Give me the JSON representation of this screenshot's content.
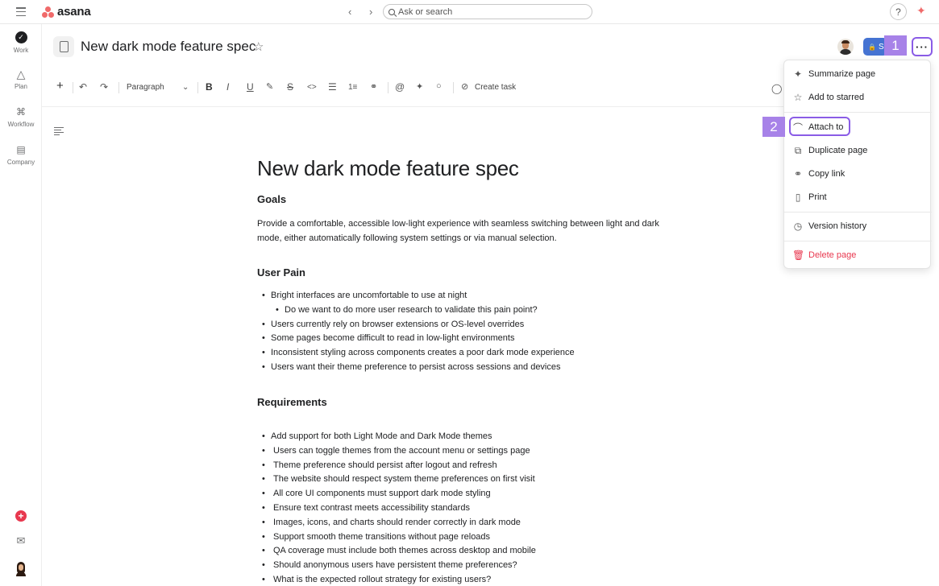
{
  "topbar": {
    "brand": "asana",
    "nav_arrows": "‹ ›",
    "search_placeholder": "Ask or search",
    "help": "?",
    "ai_icon": "sparkle-icon"
  },
  "sidebar": {
    "items": [
      {
        "label": "Work",
        "icon": "check-circle-icon"
      },
      {
        "label": "Plan",
        "icon": "triangle-icon"
      },
      {
        "label": "Workflow",
        "icon": "workflow-icon"
      },
      {
        "label": "Company",
        "icon": "building-icon"
      }
    ],
    "bottom": [
      "create-icon",
      "inbox-icon",
      "user-avatar"
    ]
  },
  "header": {
    "title": "New dark mode feature spec",
    "share_label": "S",
    "more_label": "···"
  },
  "badges": {
    "first": "1",
    "second": "2"
  },
  "toolbar": {
    "block_type": "Paragraph",
    "create_task": "Create task"
  },
  "document": {
    "title": "New dark mode feature spec",
    "goals_heading": "Goals",
    "goals_text": "Provide a comfortable, accessible low-light experience with seamless switching between light and dark mode, either automatically following system settings or via manual selection.",
    "pain_heading": "User Pain",
    "pain_items": [
      {
        "text": "Bright interfaces are uncomfortable to use at night",
        "sub": false
      },
      {
        "text": "Do we want to do more user research to validate this pain point?",
        "sub": true
      },
      {
        "text": "Users currently rely on browser extensions or OS-level overrides",
        "sub": false
      },
      {
        "text": "Some pages become difficult to read in low-light environments",
        "sub": false
      },
      {
        "text": "Inconsistent styling across components creates a poor dark mode experience",
        "sub": false
      },
      {
        "text": "Users want their theme preference to persist across sessions and devices",
        "sub": false
      }
    ],
    "req_heading": "Requirements",
    "req_items": [
      "Add support for both Light Mode and Dark Mode themes",
      "Users can toggle themes from the account menu or settings page",
      "Theme preference should persist after logout and refresh",
      "The website should respect system theme preferences on first visit",
      "All core UI components must support dark mode styling",
      "Ensure text contrast meets accessibility standards",
      "Images, icons, and charts should render correctly in dark mode",
      "Support smooth theme transitions without page reloads",
      "QA coverage must include both themes across desktop and mobile",
      "Should anonymous users have persistent theme preferences?",
      "What is the expected rollout strategy for existing users?"
    ]
  },
  "menu": {
    "items": [
      {
        "label": "Summarize page",
        "icon": "sparkle-icon"
      },
      {
        "label": "Add to starred",
        "icon": "star-icon"
      },
      {
        "label": "Attach to",
        "icon": "paperclip-icon"
      },
      {
        "label": "Duplicate page",
        "icon": "duplicate-icon"
      },
      {
        "label": "Copy link",
        "icon": "link-icon"
      },
      {
        "label": "Print",
        "icon": "print-icon"
      },
      {
        "label": "Version history",
        "icon": "clock-icon"
      },
      {
        "label": "Delete page",
        "icon": "trash-icon"
      }
    ]
  },
  "colors": {
    "brand": "#f06a6a",
    "accent": "#8a5ce6",
    "badge": "#a782e8",
    "share": "#4573d2",
    "danger": "#e8384f"
  }
}
